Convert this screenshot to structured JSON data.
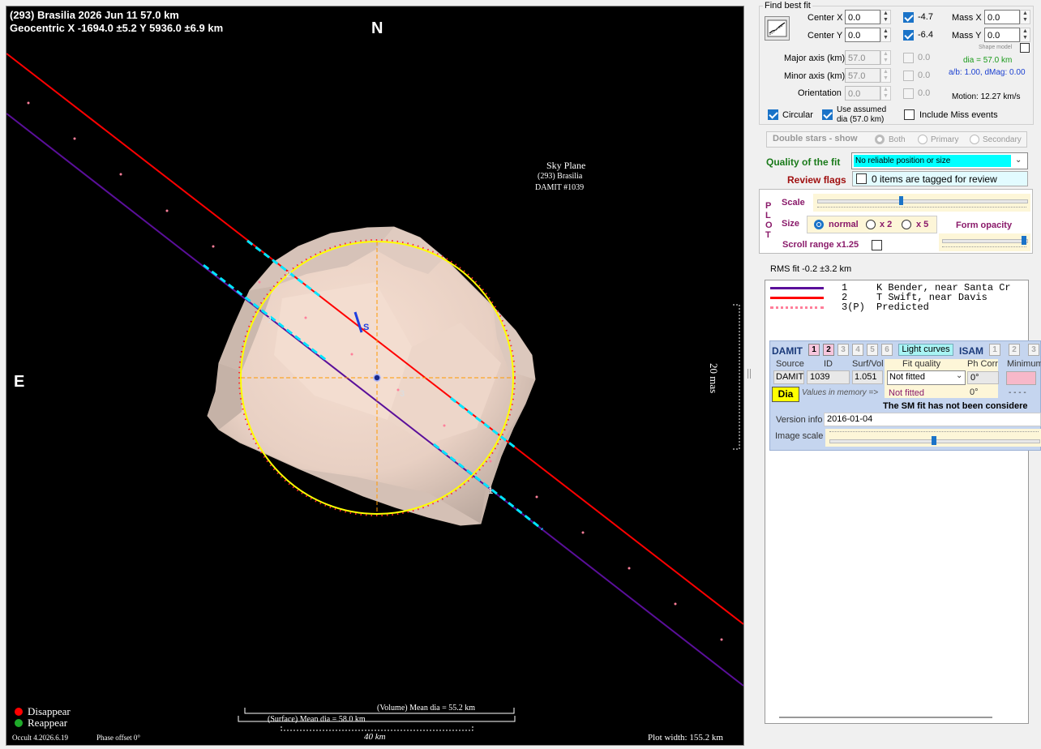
{
  "plot": {
    "title_line1": "(293) Brasilia  2026 Jun 11  57.0 km",
    "title_line2": "Geocentric  X -1694.0 ±5.2  Y 5936.0 ±6.9 km",
    "north": "N",
    "east": "E",
    "sky_plane": [
      "Sky Plane",
      "(293) Brasilia",
      "DAMIT #1039"
    ],
    "pole_label": "S",
    "scale_bar_mas": "20 mas",
    "volume_dia": "(Volume) Mean dia = 55.2 km",
    "surface_dia": "(Surface) Mean dia = 58.0 km",
    "scale_km": "40 km",
    "legend_disappear": "Disappear",
    "legend_reappear": "Reappear",
    "version": "Occult 4.2026.6.19",
    "phase_offset": "Phase offset 0°",
    "plot_width": "Plot width: 155.2 km",
    "chord_labels": [
      "1",
      "2",
      "1",
      "3"
    ],
    "colors": {
      "background": "#000000",
      "fit_ellipse": "#ffff00",
      "chord1": "#5a0f9a",
      "chord2": "#ff0000",
      "predicted": "#ff7f9a",
      "error_bar": "#00e5ff",
      "axis_cross": "#ff9900",
      "disappear": "#ff0000",
      "reappear": "#1faa2a"
    }
  },
  "find_best_fit": {
    "group_label": "Find best fit",
    "fit_button_icon": "fit-chart-icon",
    "center_x_label": "Center X",
    "center_x_value": "0.0",
    "center_x_check_value": "-4.7",
    "center_y_label": "Center Y",
    "center_y_value": "0.0",
    "center_y_check_value": "-6.4",
    "mass_x_label": "Mass X",
    "mass_x_value": "0.0",
    "mass_y_label": "Mass Y",
    "mass_y_value": "0.0",
    "shape_model_label": "Shape model",
    "dia_text": "dia = 57.0 km",
    "ab_text": "a/b: 1.00, dMag: 0.00",
    "major_axis_label": "Major axis (km)",
    "major_axis_value": "57.0",
    "major_axis_check_value": "0.0",
    "minor_axis_label": "Minor axis (km)",
    "minor_axis_value": "57.0",
    "minor_axis_check_value": "0.0",
    "orientation_label": "Orientation",
    "orientation_value": "0.0",
    "orientation_check_value": "0.0",
    "motion_text": "Motion: 12.27 km/s",
    "circular_label": "Circular",
    "use_assumed_label": "Use assumed dia (57.0 km)",
    "use_assumed_line1": "Use assumed",
    "use_assumed_line2": "dia (57.0 km)",
    "include_miss_label": "Include Miss events"
  },
  "double_stars": {
    "label": "Double stars - show",
    "options": [
      "Both",
      "Primary",
      "Secondary"
    ]
  },
  "quality": {
    "label": "Quality of the fit",
    "selected": "No reliable position or size",
    "review_label": "Review flags",
    "review_text": "0 items are tagged for review"
  },
  "plot_controls": {
    "plot_letters": [
      "P",
      "L",
      "O",
      "T"
    ],
    "scale_label": "Scale",
    "size_label": "Size",
    "size_options": [
      "normal",
      "x 2",
      "x 5"
    ],
    "form_opacity_label": "Form opacity",
    "scroll_range_label": "Scroll range x1.25",
    "scale_slider_fraction": 0.4,
    "opacity_slider_fraction": 1.0,
    "image_scale_fraction": 0.5
  },
  "rms": "RMS fit -0.2 ±3.2 km",
  "observers": [
    {
      "num": "1",
      "text": "K Bender, near Santa Cr",
      "color": "#5a0f9a",
      "style": "solid"
    },
    {
      "num": "2",
      "text": "T Swift, near Davis",
      "color": "#ff0000",
      "style": "solid"
    },
    {
      "num": "3(P)",
      "text": "Predicted",
      "color": "#ff7f9a",
      "style": "dotted"
    }
  ],
  "damit": {
    "title": "DAMIT",
    "buttons": [
      "1",
      "2",
      "3",
      "4",
      "5",
      "6"
    ],
    "light_curves": "Light curves",
    "isam": "ISAM",
    "isam_buttons": [
      "1",
      "2",
      "3"
    ],
    "col_source": "Source",
    "col_id": "ID",
    "col_surfvol": "Surf/Vol",
    "col_fit_quality": "Fit quality",
    "col_ph_corr": "Ph Corr",
    "col_minimum": "Minimum",
    "source_value": "DAMIT",
    "id_value": "1039",
    "surfvol_value": "1.051",
    "fit_quality_value": "Not fitted",
    "fit_quality_memory": "Not fitted",
    "ph_corr_value": "0°",
    "ph_corr_memory": "0°",
    "minimum_memory": "- - - -",
    "dia_button": "Dia",
    "values_in_memory": "Values in memory =>",
    "sm_fit_note": "The SM fit has not been considere",
    "version_label": "Version info",
    "version_value": "2016-01-04",
    "image_scale_label": "Image scale"
  }
}
